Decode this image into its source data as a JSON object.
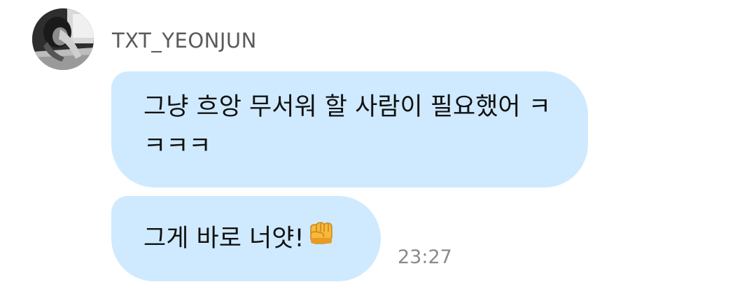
{
  "chat": {
    "sender": {
      "name": "TXT_YEONJUN",
      "avatar": "profile-photo"
    },
    "messages": [
      {
        "text": "그냥 흐앙 무서워 할 사람이 필요했어 ㅋㅋㅋㅋ"
      },
      {
        "text": "그게 바로 너얏!",
        "emoji": "fist-bump-icon",
        "time": "23:27"
      }
    ]
  },
  "colors": {
    "bubble": "#cfeaff",
    "sender_name": "#5a5a5a",
    "timestamp": "#8a8a8a"
  }
}
